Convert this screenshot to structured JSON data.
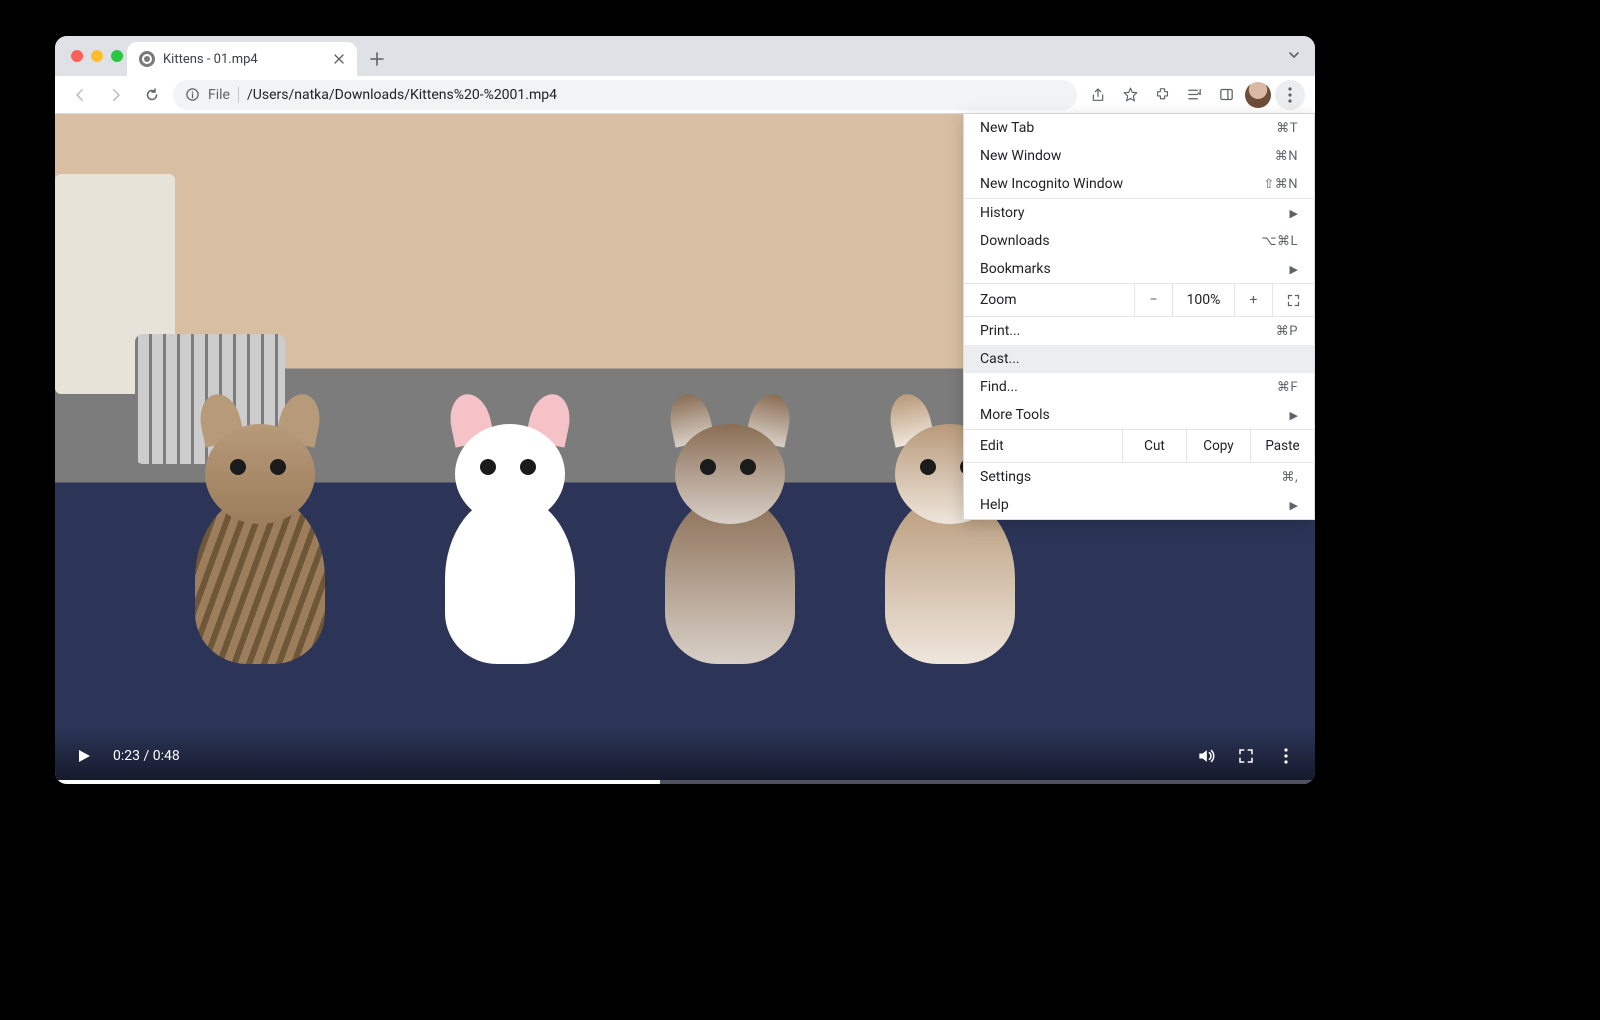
{
  "tab": {
    "title": "Kittens - 01.mp4"
  },
  "omnibox": {
    "scheme": "File",
    "path": "/Users/natka/Downloads/Kittens%20-%2001.mp4"
  },
  "video": {
    "current_time": "0:23",
    "duration": "0:48"
  },
  "menu": {
    "new_tab": {
      "label": "New Tab",
      "shortcut": "⌘T"
    },
    "new_window": {
      "label": "New Window",
      "shortcut": "⌘N"
    },
    "new_incognito": {
      "label": "New Incognito Window",
      "shortcut": "⇧⌘N"
    },
    "history": {
      "label": "History"
    },
    "downloads": {
      "label": "Downloads",
      "shortcut": "⌥⌘L"
    },
    "bookmarks": {
      "label": "Bookmarks"
    },
    "zoom": {
      "label": "Zoom",
      "value": "100%"
    },
    "print": {
      "label": "Print...",
      "shortcut": "⌘P"
    },
    "cast": {
      "label": "Cast..."
    },
    "find": {
      "label": "Find...",
      "shortcut": "⌘F"
    },
    "more_tools": {
      "label": "More Tools"
    },
    "edit": {
      "label": "Edit",
      "cut": "Cut",
      "copy": "Copy",
      "paste": "Paste"
    },
    "settings": {
      "label": "Settings",
      "shortcut": "⌘,"
    },
    "help": {
      "label": "Help"
    }
  }
}
